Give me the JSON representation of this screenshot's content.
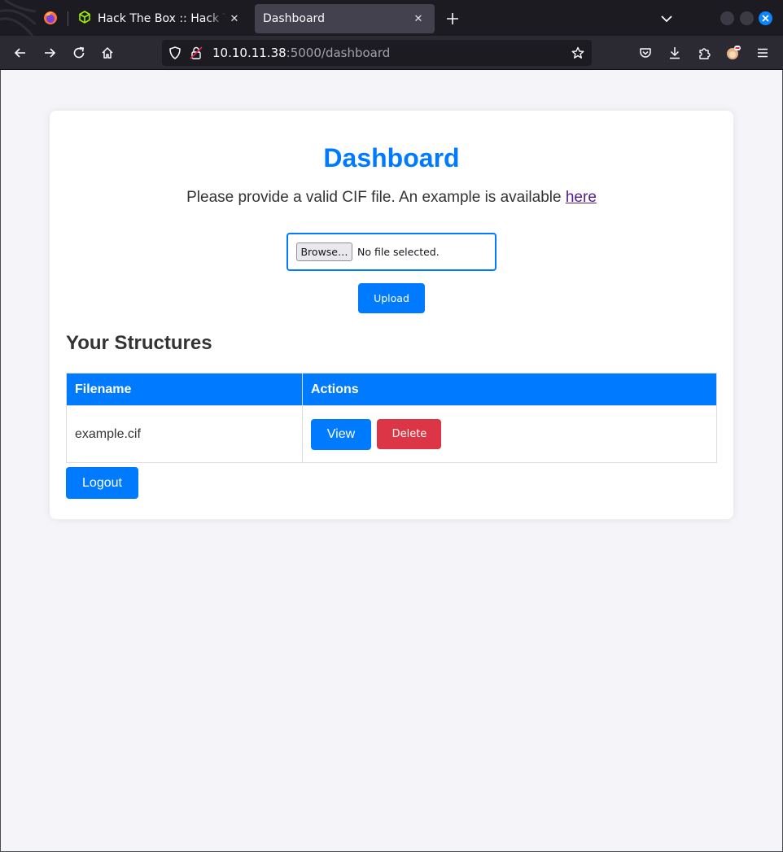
{
  "browser": {
    "tabs": [
      {
        "label": "Hack The Box :: Hack The Box",
        "active": false
      },
      {
        "label": "Dashboard",
        "active": true
      }
    ],
    "url": {
      "host": "10.10.11.38",
      "path": ":5000/dashboard"
    },
    "accent": "#0a84ff"
  },
  "page": {
    "title": "Dashboard",
    "intro_text": "Please provide a valid CIF file. An example is available ",
    "intro_link": "here",
    "file_input": {
      "button_label": "Browse…",
      "status": "No file selected."
    },
    "upload_label": "Upload",
    "section_title": "Your Structures",
    "table": {
      "headers": [
        "Filename",
        "Actions"
      ],
      "rows": [
        {
          "filename": "example.cif",
          "view_label": "View",
          "delete_label": "Delete"
        }
      ]
    },
    "logout_label": "Logout",
    "colors": {
      "primary": "#007bff",
      "danger": "#dc3545",
      "background": "#f4f4f9"
    }
  }
}
